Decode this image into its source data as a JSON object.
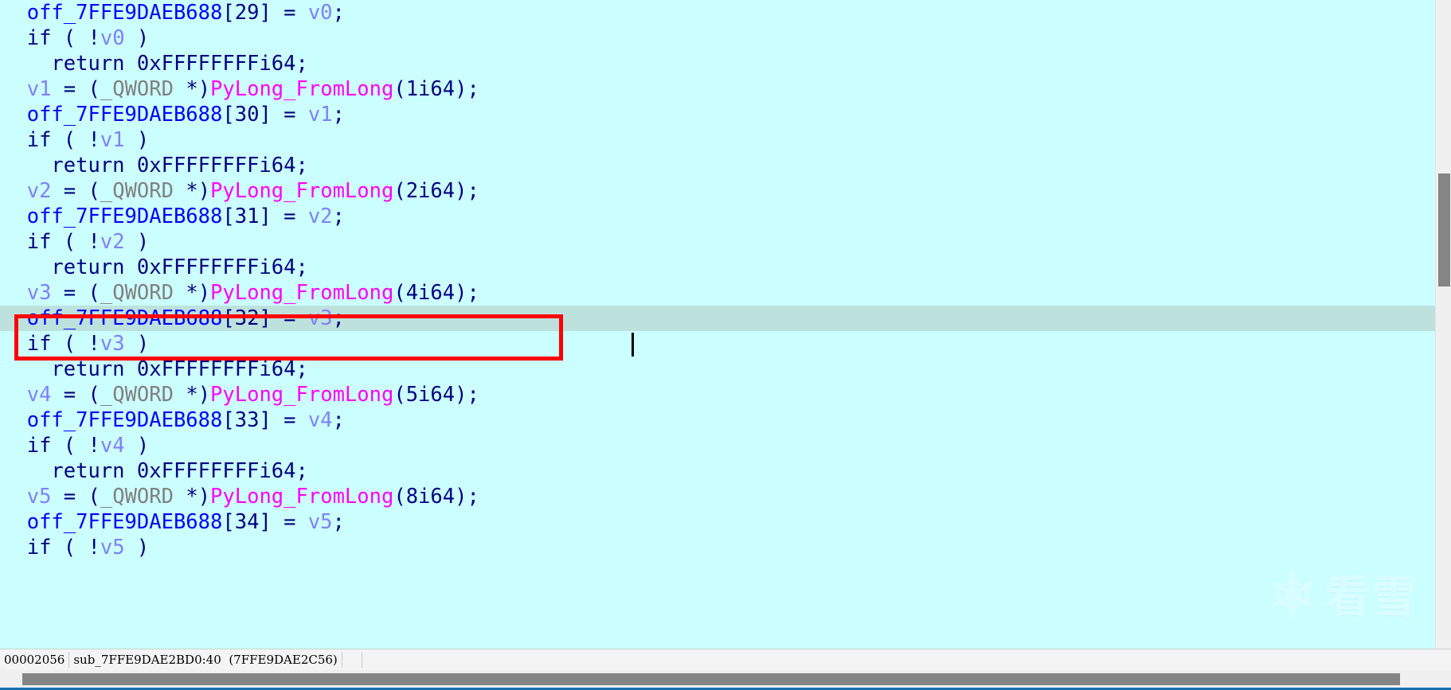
{
  "window": {
    "kind": "ida-pseudocode-view",
    "background_color": "#ccffff"
  },
  "code": {
    "font_colors": {
      "plain": "#000080",
      "local_variable": "#8080ff",
      "global_name": "#0000ff",
      "function_name": "#ff00ff",
      "type_keyword": "#808080",
      "highlight_line_bg": "#bde2de",
      "annotation_box": "#ff0000"
    },
    "lines": [
      {
        "indent": 2,
        "tokens": [
          {
            "t": "gvar",
            "s": "off_7FFE9DAEB688"
          },
          {
            "t": "plain",
            "s": "[29] = "
          },
          {
            "t": "var",
            "s": "v0"
          },
          {
            "t": "plain",
            "s": ";"
          }
        ]
      },
      {
        "indent": 2,
        "tokens": [
          {
            "t": "plain",
            "s": "if ( !"
          },
          {
            "t": "var",
            "s": "v0"
          },
          {
            "t": "plain",
            "s": " )"
          }
        ]
      },
      {
        "indent": 4,
        "tokens": [
          {
            "t": "plain",
            "s": "return 0xFFFFFFFFi64;"
          }
        ]
      },
      {
        "indent": 2,
        "tokens": [
          {
            "t": "var",
            "s": "v1"
          },
          {
            "t": "plain",
            "s": " = ("
          },
          {
            "t": "type",
            "s": "_QWORD"
          },
          {
            "t": "plain",
            "s": " *)"
          },
          {
            "t": "func",
            "s": "PyLong_FromLong"
          },
          {
            "t": "plain",
            "s": "(1i64);"
          }
        ]
      },
      {
        "indent": 2,
        "tokens": [
          {
            "t": "gvar",
            "s": "off_7FFE9DAEB688"
          },
          {
            "t": "plain",
            "s": "[30] = "
          },
          {
            "t": "var",
            "s": "v1"
          },
          {
            "t": "plain",
            "s": ";"
          }
        ]
      },
      {
        "indent": 2,
        "tokens": [
          {
            "t": "plain",
            "s": "if ( !"
          },
          {
            "t": "var",
            "s": "v1"
          },
          {
            "t": "plain",
            "s": " )"
          }
        ]
      },
      {
        "indent": 4,
        "tokens": [
          {
            "t": "plain",
            "s": "return 0xFFFFFFFFi64;"
          }
        ]
      },
      {
        "indent": 2,
        "tokens": [
          {
            "t": "var",
            "s": "v2"
          },
          {
            "t": "plain",
            "s": " = ("
          },
          {
            "t": "type",
            "s": "_QWORD"
          },
          {
            "t": "plain",
            "s": " *)"
          },
          {
            "t": "func",
            "s": "PyLong_FromLong"
          },
          {
            "t": "plain",
            "s": "(2i64);"
          }
        ]
      },
      {
        "indent": 2,
        "tokens": [
          {
            "t": "gvar",
            "s": "off_7FFE9DAEB688"
          },
          {
            "t": "plain",
            "s": "[31] = "
          },
          {
            "t": "var",
            "s": "v2"
          },
          {
            "t": "plain",
            "s": ";"
          }
        ]
      },
      {
        "indent": 2,
        "tokens": [
          {
            "t": "plain",
            "s": "if ( !"
          },
          {
            "t": "var",
            "s": "v2"
          },
          {
            "t": "plain",
            "s": " )"
          }
        ]
      },
      {
        "indent": 4,
        "tokens": [
          {
            "t": "plain",
            "s": "return 0xFFFFFFFFi64;"
          }
        ]
      },
      {
        "indent": 2,
        "tokens": [
          {
            "t": "var",
            "s": "v3"
          },
          {
            "t": "plain",
            "s": " = ("
          },
          {
            "t": "type",
            "s": "_QWORD"
          },
          {
            "t": "plain",
            "s": " *)"
          },
          {
            "t": "func",
            "s": "PyLong_FromLong"
          },
          {
            "t": "plain",
            "s": "(4i64);"
          }
        ]
      },
      {
        "indent": 2,
        "highlight": true,
        "tokens": [
          {
            "t": "gvar",
            "s": "off_7FFE9DAEB688"
          },
          {
            "t": "plain",
            "s": "[32] = "
          },
          {
            "t": "var",
            "s": "v3"
          },
          {
            "t": "plain",
            "s": ";"
          }
        ]
      },
      {
        "indent": 2,
        "tokens": [
          {
            "t": "plain",
            "s": "if ( !"
          },
          {
            "t": "var",
            "s": "v3"
          },
          {
            "t": "plain",
            "s": " )"
          }
        ]
      },
      {
        "indent": 4,
        "tokens": [
          {
            "t": "plain",
            "s": "return 0xFFFFFFFFi64;"
          }
        ]
      },
      {
        "indent": 2,
        "tokens": [
          {
            "t": "var",
            "s": "v4"
          },
          {
            "t": "plain",
            "s": " = ("
          },
          {
            "t": "type",
            "s": "_QWORD"
          },
          {
            "t": "plain",
            "s": " *)"
          },
          {
            "t": "func",
            "s": "PyLong_FromLong"
          },
          {
            "t": "plain",
            "s": "(5i64);"
          }
        ]
      },
      {
        "indent": 2,
        "tokens": [
          {
            "t": "gvar",
            "s": "off_7FFE9DAEB688"
          },
          {
            "t": "plain",
            "s": "[33] = "
          },
          {
            "t": "var",
            "s": "v4"
          },
          {
            "t": "plain",
            "s": ";"
          }
        ]
      },
      {
        "indent": 2,
        "tokens": [
          {
            "t": "plain",
            "s": "if ( !"
          },
          {
            "t": "var",
            "s": "v4"
          },
          {
            "t": "plain",
            "s": " )"
          }
        ]
      },
      {
        "indent": 4,
        "tokens": [
          {
            "t": "plain",
            "s": "return 0xFFFFFFFFi64;"
          }
        ]
      },
      {
        "indent": 2,
        "tokens": [
          {
            "t": "var",
            "s": "v5"
          },
          {
            "t": "plain",
            "s": " = ("
          },
          {
            "t": "type",
            "s": "_QWORD"
          },
          {
            "t": "plain",
            "s": " *)"
          },
          {
            "t": "func",
            "s": "PyLong_FromLong"
          },
          {
            "t": "plain",
            "s": "(8i64);"
          }
        ]
      },
      {
        "indent": 2,
        "tokens": [
          {
            "t": "gvar",
            "s": "off_7FFE9DAEB688"
          },
          {
            "t": "plain",
            "s": "[34] = "
          },
          {
            "t": "var",
            "s": "v5"
          },
          {
            "t": "plain",
            "s": ";"
          }
        ]
      },
      {
        "indent": 2,
        "tokens": [
          {
            "t": "plain",
            "s": "if ( !"
          },
          {
            "t": "var",
            "s": "v5"
          },
          {
            "t": "plain",
            "s": " )"
          }
        ]
      }
    ]
  },
  "annotation": {
    "shape": "rectangle",
    "color": "#ff0000",
    "covers_lines": [
      "v3 = (_QWORD *)PyLong_FromLong(4i64);",
      "off_7FFE9DAEB688[32] = v3;"
    ]
  },
  "status_bar": {
    "offset": "00002056",
    "location": "sub_7FFE9DAE2BD0:40",
    "address": "(7FFE9DAE2C56)"
  },
  "scrollbars": {
    "vertical": {
      "thumb_top_pct": 27,
      "thumb_height_pct": 17
    },
    "horizontal": {
      "thumb_left_pct": 2,
      "thumb_width_pct": 95
    }
  },
  "watermark": {
    "text": "看雪",
    "icon": "snowflake-icon"
  }
}
